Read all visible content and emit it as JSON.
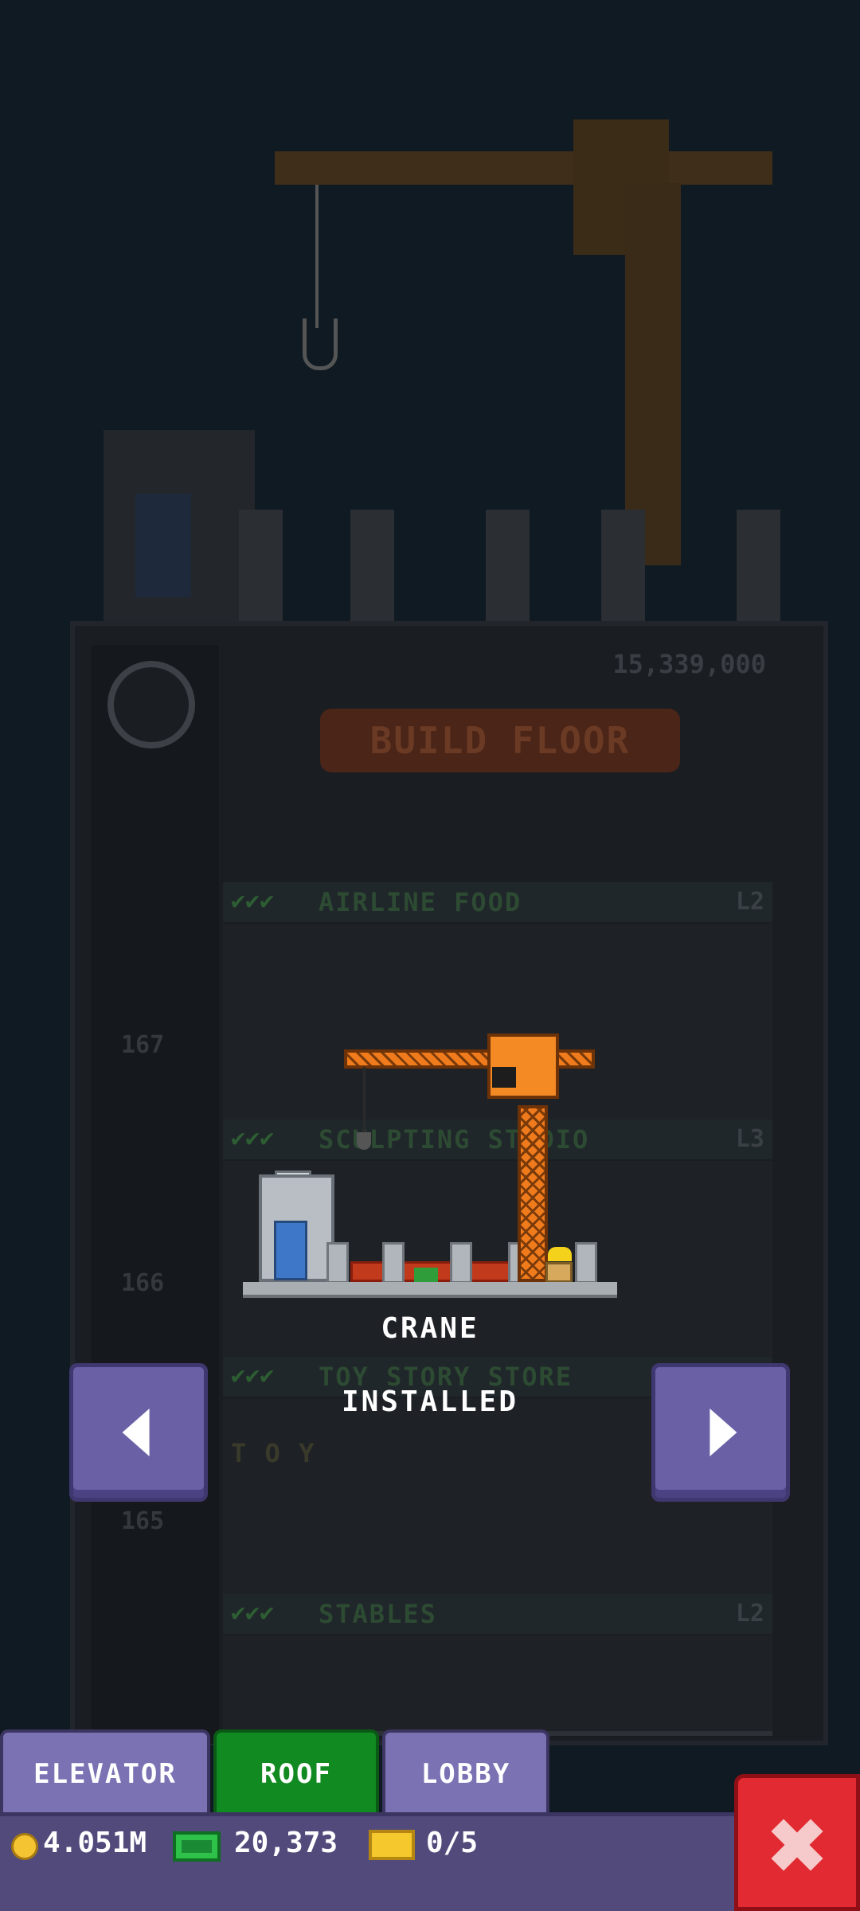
{
  "background": {
    "price": "15,339,000",
    "build_button": "BUILD FLOOR",
    "floors": [
      {
        "name": "AIRLINE FOOD",
        "level": "L2",
        "number": ""
      },
      {
        "name": "SCULPTING STUDIO",
        "level": "L3",
        "number": "167"
      },
      {
        "name": "TOY STORY STORE",
        "level": "",
        "number": "166"
      },
      {
        "name": "STABLES",
        "level": "L2",
        "number": "165"
      }
    ],
    "toy_sign": "T O Y"
  },
  "preview": {
    "title": "CRANE",
    "status": "INSTALLED"
  },
  "nav": {
    "prev_icon": "arrow-left-icon",
    "next_icon": "arrow-right-icon"
  },
  "tabs": [
    {
      "label": "ELEVATOR",
      "active": false
    },
    {
      "label": "ROOF",
      "active": true
    },
    {
      "label": "LOBBY",
      "active": false
    }
  ],
  "status_bar": {
    "coins": "4.051M",
    "bux": "20,373",
    "tickets": "0/5"
  },
  "colors": {
    "active_tab": "#128a22",
    "tab": "#7b72b3",
    "nav_button": "#6a60a6",
    "close_button": "#e12a31",
    "crane_orange": "#f07b1c"
  }
}
